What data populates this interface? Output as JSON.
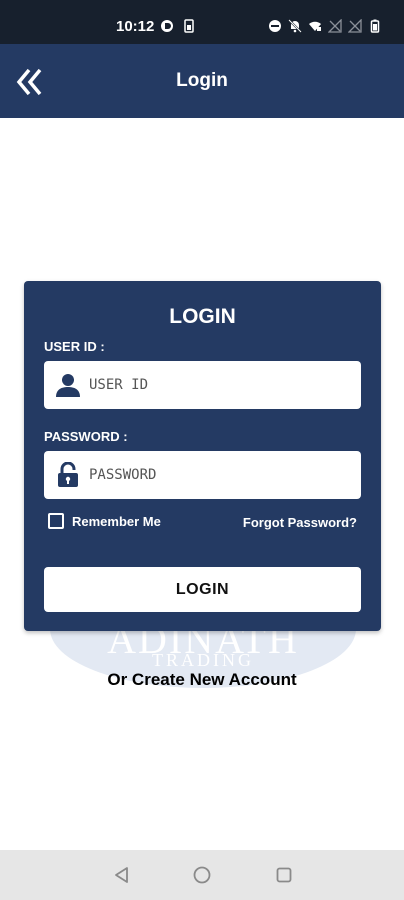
{
  "status_bar": {
    "time": "10:12",
    "icons": [
      "data-saver-icon",
      "sim-icon",
      "dnd-icon",
      "mute-icon",
      "wifi-icon",
      "no-signal-icon",
      "no-signal-icon",
      "battery-icon"
    ]
  },
  "app_bar": {
    "title": "Login",
    "back_icon": "double-chevron-left-icon"
  },
  "card": {
    "title": "LOGIN",
    "user_id_label": "USER ID :",
    "user_id_placeholder": "USER ID",
    "password_label": "PASSWORD :",
    "password_placeholder": "PASSWORD",
    "remember_label": "Remember Me",
    "remember_checked": false,
    "forgot_label": "Forgot Password?",
    "login_button": "LOGIN"
  },
  "watermark": {
    "main": "ADINATH",
    "sub": "TRADING"
  },
  "create_account": "Or Create New Account",
  "colors": {
    "primary": "#243a63",
    "status_bar": "#17202d",
    "nav_bar": "#e6e6e6"
  },
  "nav_bar": {
    "icons": [
      "back-triangle-icon",
      "home-circle-icon",
      "recents-square-icon"
    ]
  }
}
